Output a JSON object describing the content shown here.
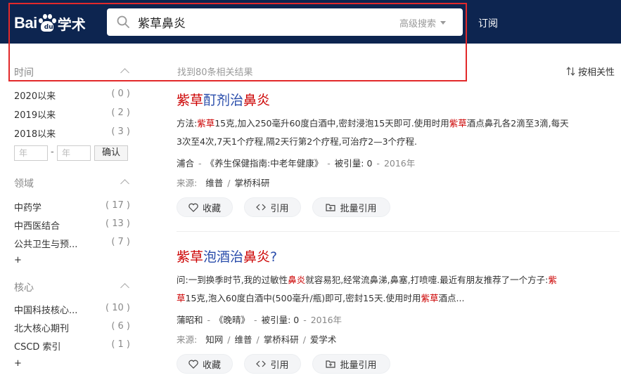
{
  "header": {
    "logo_text_bai": "Bai",
    "logo_text_du": "du",
    "logo_text_xueshu": "学术",
    "search_value": "紫草鼻炎",
    "advanced_search": "高级搜索",
    "subscribe": "订阅",
    "bg_color": "#0d2550"
  },
  "sidebar": {
    "time": {
      "title": "时间",
      "items": [
        {
          "label": "2020以来",
          "count": "( 0 )"
        },
        {
          "label": "2019以来",
          "count": "( 2 )"
        },
        {
          "label": "2018以来",
          "count": "( 3 )"
        }
      ],
      "from_placeholder": "年",
      "dash": "-",
      "to_placeholder": "年",
      "confirm": "确认"
    },
    "field": {
      "title": "领域",
      "items": [
        {
          "label": "中药学",
          "count": "( 17 )"
        },
        {
          "label": "中西医结合",
          "count": "( 13 )"
        },
        {
          "label": "公共卫生与预...",
          "count": "( 7 )"
        }
      ],
      "more": "+"
    },
    "core": {
      "title": "核心",
      "items": [
        {
          "label": "中国科技核心...",
          "count": "( 10 )"
        },
        {
          "label": "北大核心期刊",
          "count": "( 6 )"
        },
        {
          "label": "CSCD 索引",
          "count": "( 1 )"
        }
      ],
      "more": "+"
    }
  },
  "results": {
    "count_text": "找到80条相关结果",
    "sort_label": "按相关性",
    "items": [
      {
        "title_hl1": "紫草",
        "title_mid": "酊剂治",
        "title_hl2": "鼻炎",
        "title_end": "",
        "abstract_line1_a": "方法:",
        "abstract_line1_hl1": "紫草",
        "abstract_line1_b": "15克,加入250毫升60度白酒中,密封浸泡15天即可.使用时用",
        "abstract_line1_hl2": "紫草",
        "abstract_line1_c": "酒点鼻孔各2滴至3滴,每天",
        "abstract_line2": "3次至4次,7天1个疗程,隔2天行第2个疗程,可治疗2—3个疗程.",
        "author": "浦合",
        "journal": "《养生保健指南:中老年健康》",
        "cited_label": "被引量:",
        "cited": "0",
        "year": "2016年",
        "source_label": "来源:",
        "sources": [
          "维普",
          "掌桥科研"
        ]
      },
      {
        "title_hl1": "紫草",
        "title_mid": "泡酒治",
        "title_hl2": "鼻炎",
        "title_end": "?",
        "abstract_line1_a": "问:一到换季时节,我的过敏性",
        "abstract_line1_hl1": "鼻炎",
        "abstract_line1_b": "就容易犯,经常流鼻涕,鼻塞,打喷嚏.最近有朋友推荐了一个方子:",
        "abstract_line1_hl2": "紫",
        "abstract_line1_c": "",
        "abstract_line2_hl": "草",
        "abstract_line2_a": "15克,泡入60度白酒中(500毫升/瓶)即可,密封15天.使用时用",
        "abstract_line2_hl2": "紫草",
        "abstract_line2_b": "酒点...",
        "author": "蒲昭和",
        "journal": "《晚晴》",
        "cited_label": "被引量:",
        "cited": "0",
        "year": "2016年",
        "source_label": "来源:",
        "sources": [
          "知网",
          "维普",
          "掌桥科研",
          "爱学术"
        ]
      }
    ],
    "actions": {
      "favorite": "收藏",
      "cite": "引用",
      "batch_cite": "批量引用"
    }
  },
  "colors": {
    "highlight_red": "#c00",
    "title_blue": "#2a4dab",
    "annotation_box": "#e2292a"
  }
}
